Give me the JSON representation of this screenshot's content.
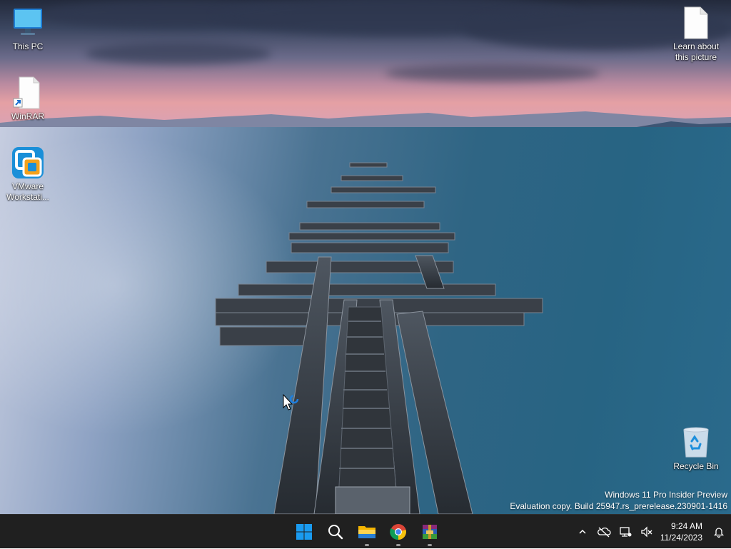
{
  "desktop": {
    "icons": [
      {
        "label": "This PC",
        "icon": "monitor-icon"
      },
      {
        "label": "WinRAR",
        "icon": "file-shortcut-icon"
      },
      {
        "label": "VMware Workstati...",
        "icon": "vmware-icon"
      },
      {
        "label": "Learn about this picture",
        "icon": "file-icon"
      },
      {
        "label": "Recycle Bin",
        "icon": "recycle-bin-icon"
      }
    ],
    "watermark": {
      "line1": "Windows 11 Pro Insider Preview",
      "line2": "Evaluation copy. Build 25947.rs_prerelease.230901-1416"
    }
  },
  "taskbar": {
    "apps": [
      {
        "icon": "windows-start-icon",
        "running": false
      },
      {
        "icon": "search-icon",
        "running": false
      },
      {
        "icon": "file-explorer-icon",
        "running": true
      },
      {
        "icon": "chrome-icon",
        "running": true
      },
      {
        "icon": "winrar-icon",
        "running": true
      }
    ],
    "tray": {
      "icons": [
        "chevron-up-icon",
        "onedrive-offline-icon",
        "network-icon",
        "volume-muted-icon"
      ],
      "time": "9:24 AM",
      "date": "11/24/2023",
      "notification_icon": "bell-icon"
    }
  },
  "colors": {
    "taskbar_bg": "#202020",
    "windows_blue": "#0a84d8"
  }
}
